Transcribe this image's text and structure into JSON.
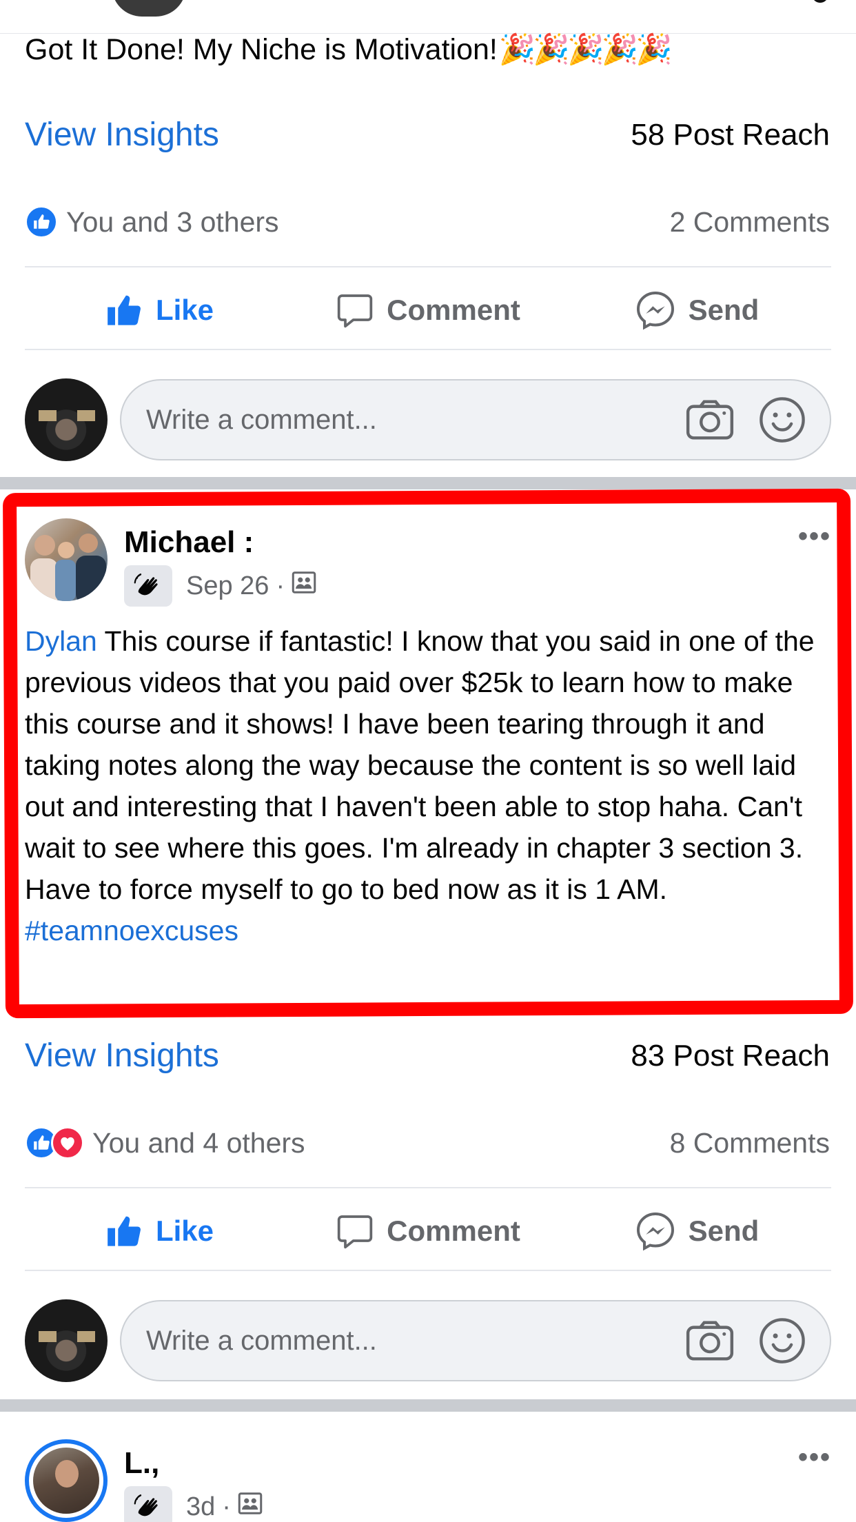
{
  "colors": {
    "link_blue": "#1b6fd6",
    "like_blue": "#1877f2",
    "love_red": "#f02849",
    "highlight_red": "#ff0000",
    "muted_gray": "#65676b"
  },
  "prev_post": {
    "text": "Got It Done! My Niche is Motivation!",
    "emoji": "🎉🎉🎉🎉🎉",
    "insights_label": "View Insights",
    "post_reach": "58 Post Reach",
    "reactions_label": "You and 3 others",
    "reaction_icons": [
      "like-icon"
    ],
    "comments_count": "2 Comments"
  },
  "actions": {
    "like": "Like",
    "comment": "Comment",
    "send": "Send"
  },
  "comment_input": {
    "placeholder": "Write a comment..."
  },
  "main_post": {
    "author": "Michael :",
    "date": "Sep 26",
    "dot": "·",
    "mention": "Dylan",
    "body": " This course if fantastic! I know that you said in one of the previous videos that you paid over $25k to learn how to make this course and it shows! I have been tearing through it and taking notes along the way because the content is so well laid out and interesting that I haven't been able to stop haha. Can't wait to see where this goes. I'm already in chapter 3 section 3. Have to force myself to go to bed now as it is 1 AM.",
    "hashtag": "#teamnoexcuses",
    "insights_label": "View Insights",
    "post_reach": "83 Post Reach",
    "reactions_label": "You and 4 others",
    "reaction_icons": [
      "like-icon",
      "love-icon"
    ],
    "comments_count": "8 Comments",
    "more": "•••"
  },
  "next_post": {
    "author": "L.,",
    "date": "3d",
    "dot": "·",
    "more": "•••"
  }
}
